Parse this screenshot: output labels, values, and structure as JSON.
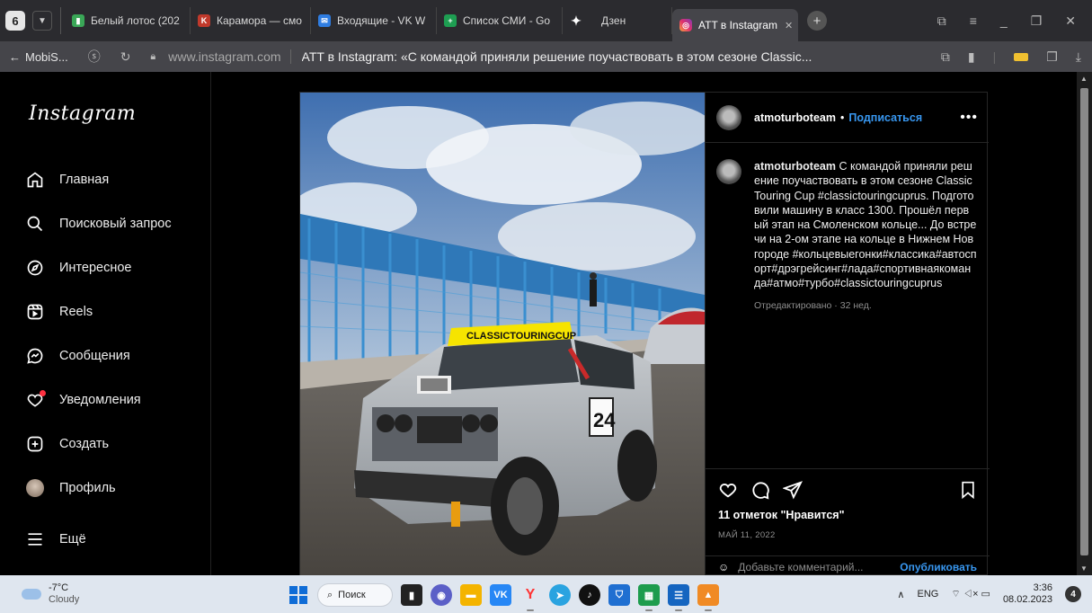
{
  "browser": {
    "tab_count": "6",
    "tabs": [
      {
        "label": "Белый лотос (202",
        "color": "#3aa757",
        "icon": "tv-icon"
      },
      {
        "label": "Карамора — смо",
        "color": "#c0392b",
        "icon": "kinopoisk-icon"
      },
      {
        "label": "Входящие - VK W",
        "color": "#2f7de1",
        "icon": "mail-icon"
      },
      {
        "label": "Список СМИ - Go",
        "color": "#1e9e52",
        "icon": "sheets-icon"
      },
      {
        "label": "Дзен",
        "color": "#ffffff",
        "icon": "zen-icon"
      },
      {
        "label": "ATT в Instagram",
        "color": "#e1306c",
        "icon": "instagram-icon"
      }
    ],
    "back_label": "MobiS...",
    "url_host": "www.instagram.com",
    "page_title": "ATT в Instagram: «С командой приняли решение поучаствовать в этом сезоне Classic..."
  },
  "sidebar": {
    "logo": "Instagram",
    "items": [
      {
        "label": "Главная",
        "icon": "home-icon"
      },
      {
        "label": "Поисковый запрос",
        "icon": "search-icon"
      },
      {
        "label": "Интересное",
        "icon": "compass-icon"
      },
      {
        "label": "Reels",
        "icon": "reels-icon"
      },
      {
        "label": "Сообщения",
        "icon": "messenger-icon"
      },
      {
        "label": "Уведомления",
        "icon": "heart-icon"
      },
      {
        "label": "Создать",
        "icon": "plus-square-icon"
      },
      {
        "label": "Профиль",
        "icon": "avatar"
      },
      {
        "label": "Ещё",
        "icon": "menu-icon"
      }
    ]
  },
  "post": {
    "username": "atmoturboteam",
    "follow_label": "Подписаться",
    "caption": "С командой приняли решение поучаствовать в этом сезоне Classic Touring Cup #classictouringcuprus. Подготовили машину в класс 1300. Прошёл первый этап на Смоленском кольце... До встречи на 2-ом этапе на кольце в Нижнем Новгороде #кольцевыегонки#классика#автоспорт#дрэгрейсинг#лада#спортивнаякоманда#атмо#турбо#classictouringcuprus",
    "edited": "Отредактировано · 32 нед.",
    "likes": "11 отметок \"Нравится\"",
    "date": "МАЙ 11, 2022",
    "comment_placeholder": "Добавьте комментарий...",
    "publish_label": "Опубликовать",
    "car_number": "24",
    "windshield_banner": "CLASSICTOURINGCUP"
  },
  "taskbar": {
    "temperature": "-7°C",
    "weather": "Cloudy",
    "search_label": "Поиск",
    "lang": "ENG",
    "time": "3:36",
    "date": "08.02.2023",
    "notifications": "4"
  }
}
